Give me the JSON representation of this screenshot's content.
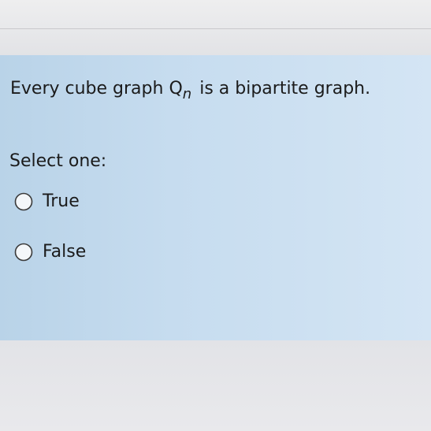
{
  "question": {
    "text_before": "Every cube graph",
    "symbol": "Q",
    "symbol_subscript": "n",
    "text_after": "is a bipartite graph."
  },
  "prompt": "Select one:",
  "options": [
    {
      "label": "True",
      "selected": false
    },
    {
      "label": "False",
      "selected": false
    }
  ],
  "colors": {
    "panel": "#c6dcef",
    "text": "#1b1b1b",
    "radio_border": "#3a3a3a"
  },
  "icons": {
    "radio": "radio-button-icon"
  }
}
